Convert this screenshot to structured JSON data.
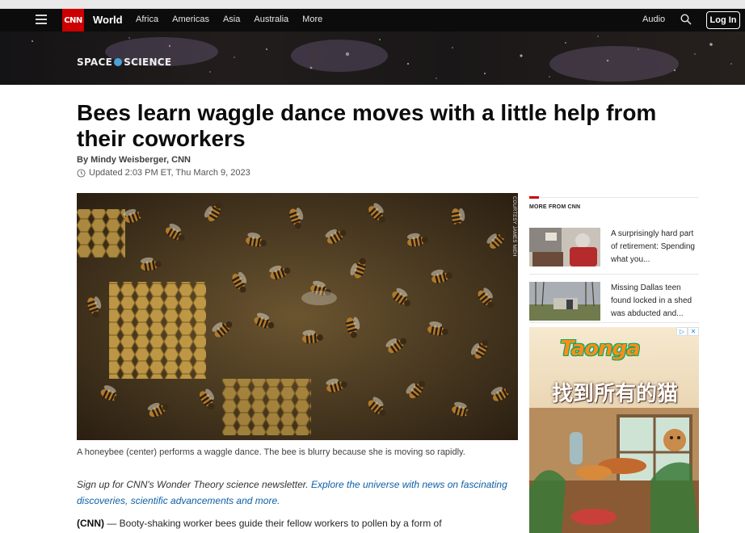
{
  "nav": {
    "section": "World",
    "logo": "CNN",
    "links": [
      "Africa",
      "Americas",
      "Asia",
      "Australia",
      "More"
    ],
    "audio": "Audio",
    "login": "Log In"
  },
  "banner": {
    "label_left": "SPACE",
    "label_right": "SCIENCE"
  },
  "article": {
    "headline": "Bees learn waggle dance moves with a little help from their coworkers",
    "byline": "By Mindy Weisberger, CNN",
    "timestamp": "Updated 2:03 PM ET, Thu March 9, 2023",
    "image_credit": "COURTESY JAMES NIEH",
    "caption": "A honeybee (center) performs a waggle dance. The bee is blurry because she is moving so rapidly.",
    "newsletter_prefix": "Sign up for CNN's Wonder Theory science newsletter. ",
    "newsletter_link": "Explore the universe with news on fascinating discoveries, scientific advancements and more.",
    "body_lead": "(CNN)",
    "body_text": " — Booty-shaking worker bees guide their fellow workers to pollen by a form of"
  },
  "more_from_cnn": {
    "title": "MORE FROM CNN",
    "items": [
      {
        "text": "A surprisingly hard part of retirement: Spending what you..."
      },
      {
        "text": "Missing Dallas teen found locked in a shed was abducted and..."
      }
    ]
  },
  "ad": {
    "logo": "Taonga",
    "tagline": "找到所有的猫",
    "close_icon": "close-icon",
    "info_icon": "adchoices-icon"
  },
  "colors": {
    "cnn_red": "#cc0000",
    "nav_bg": "#0c0c0c",
    "link_blue": "#0c5fa8"
  }
}
